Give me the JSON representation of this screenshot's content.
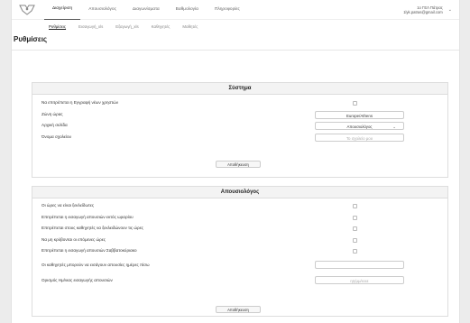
{
  "nav": {
    "items": [
      "Διαχείριση",
      "Απουσιολόγος",
      "Διαγωνίσματα",
      "Βαθμολογία",
      "Πληροφορίες"
    ],
    "active_index": 0
  },
  "user": {
    "name": "1ο ΓΕΛ Πάτρας",
    "email": "1lyk.patras@gmail.com"
  },
  "subnav": {
    "items": [
      "Ρυθμίσεις",
      "Εισαγωγή_xls",
      "Εξαγωγή_xls",
      "Καθηγητές",
      "Μαθητές"
    ],
    "active_index": 0
  },
  "page_title": "Ρυθμίσεις",
  "system": {
    "header": "Σύστημα",
    "allow_register_label": "Να επιτρέπεται η Εγγραφή νέων χρηστών",
    "timezone_label": "Ζώνη ώρας",
    "timezone_value": "Europe/Athens",
    "homepage_label": "Αρχική σελίδα",
    "homepage_value": "Απουσιολόγος",
    "school_name_label": "Όνομα σχολείου",
    "school_name_placeholder": "Το σχολείο μου",
    "save_label": "Αποθήκευση"
  },
  "absences": {
    "header": "Απουσιολόγος",
    "hours_unlocked_label": "Οι ώρες να είναι ξεκλείδωτες",
    "off_schedule_label": "Επιτρέπεται η εισαγωγή απουσιών εκτός ωραρίου",
    "teachers_unlock_label": "Επιτρέπεται στους καθηγητές να ξεκλειδώνουν τις ώρες",
    "no_hide_next_label": "Να μη κρύβονται οι επόμενες ώρες",
    "weekend_label": "Επιτρέπεται η εισαγωγή απουσιών Σαββατοκύριακο",
    "days_back_label": "Οι καθηγητές μπορούν να εισάγουν απουσίες ημέρες πίσω",
    "date_label": "Ορισμός Ημ/νιας εισαγωγής απουσιών",
    "date_placeholder": "ηη/μμ/εεεε",
    "save_label": "Αποθήκευση"
  }
}
